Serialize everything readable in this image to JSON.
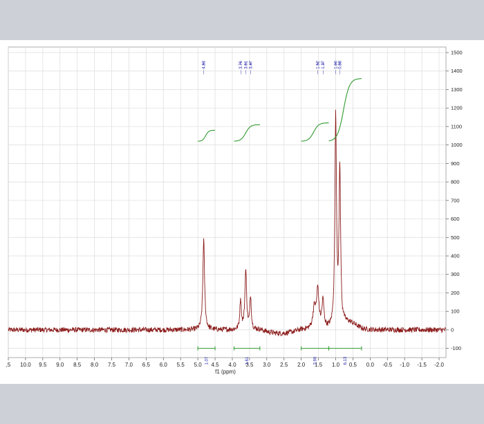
{
  "chart_data": {
    "type": "line",
    "title": "",
    "xlabel": "f1 (ppm)",
    "ylabel": "",
    "xlim": [
      10.5,
      -2.2
    ],
    "ylim": [
      -150,
      1530
    ],
    "x_reversed": true,
    "grid": true,
    "x_ticks": [
      10.5,
      10.0,
      9.5,
      9.0,
      8.5,
      8.0,
      7.5,
      7.0,
      6.5,
      6.0,
      5.5,
      5.0,
      4.5,
      4.0,
      3.5,
      3.0,
      2.5,
      2.0,
      1.5,
      1.0,
      0.5,
      0.0,
      -0.5,
      -1.0,
      -1.5,
      -2.0
    ],
    "x_tick_labels": [
      ",5",
      "10.0",
      "9.5",
      "9.0",
      "8.5",
      "8.0",
      "7.5",
      "7.0",
      "6.5",
      "6.0",
      "5.5",
      "5.0",
      "4.5",
      "4.0",
      "3.5",
      "3.0",
      "2.5",
      "2.0",
      "1.5",
      "1.0",
      "0.5",
      "0.0",
      "-0.5",
      "-1.0",
      "-1.5",
      "-2.0"
    ],
    "y_ticks": [
      -100,
      0,
      100,
      200,
      300,
      400,
      500,
      600,
      700,
      800,
      900,
      1000,
      1100,
      1200,
      1300,
      1400,
      1500
    ],
    "y_tick_labels": [
      "-100",
      "0",
      "100",
      "200",
      "300",
      "400",
      "500",
      "600",
      "700",
      "800",
      "900",
      "1000",
      "1100",
      "1200",
      "1300",
      "1400",
      "1500"
    ],
    "spectrum_color": "#8b1a1a",
    "integral_color": "#2e9a2e",
    "label_color": "#1a1aa8",
    "peaks": [
      {
        "ppm": 4.83,
        "height": 490,
        "width": 0.03
      },
      {
        "ppm": 3.76,
        "height": 165,
        "width": 0.025
      },
      {
        "ppm": 3.61,
        "height": 320,
        "width": 0.03
      },
      {
        "ppm": 3.47,
        "height": 175,
        "width": 0.025
      },
      {
        "ppm": 1.62,
        "height": 110,
        "width": 0.05
      },
      {
        "ppm": 1.52,
        "height": 205,
        "width": 0.04
      },
      {
        "ppm": 1.37,
        "height": 150,
        "width": 0.035
      },
      {
        "ppm": 1.0,
        "height": 1140,
        "width": 0.028
      },
      {
        "ppm": 0.88,
        "height": 860,
        "width": 0.028
      }
    ],
    "peak_labels": [
      "4.83",
      "3.76",
      "3.61",
      "3.47",
      "1.52",
      "1.37",
      "1.00",
      "0.88"
    ],
    "peak_label_ppm": [
      4.83,
      3.76,
      3.61,
      3.47,
      1.52,
      1.37,
      1.0,
      0.88
    ],
    "integrals": [
      {
        "label": "1.07",
        "from": 5.0,
        "to": 4.5,
        "y0": 1020,
        "y1": 1080
      },
      {
        "label": "1.61",
        "from": 3.95,
        "to": 3.2,
        "y0": 1020,
        "y1": 1110
      },
      {
        "label": "2.90",
        "from": 2.0,
        "to": 1.2,
        "y0": 1020,
        "y1": 1120
      },
      {
        "label": "6.13",
        "from": 1.2,
        "to": 0.25,
        "y0": 1020,
        "y1": 1360
      }
    ]
  }
}
